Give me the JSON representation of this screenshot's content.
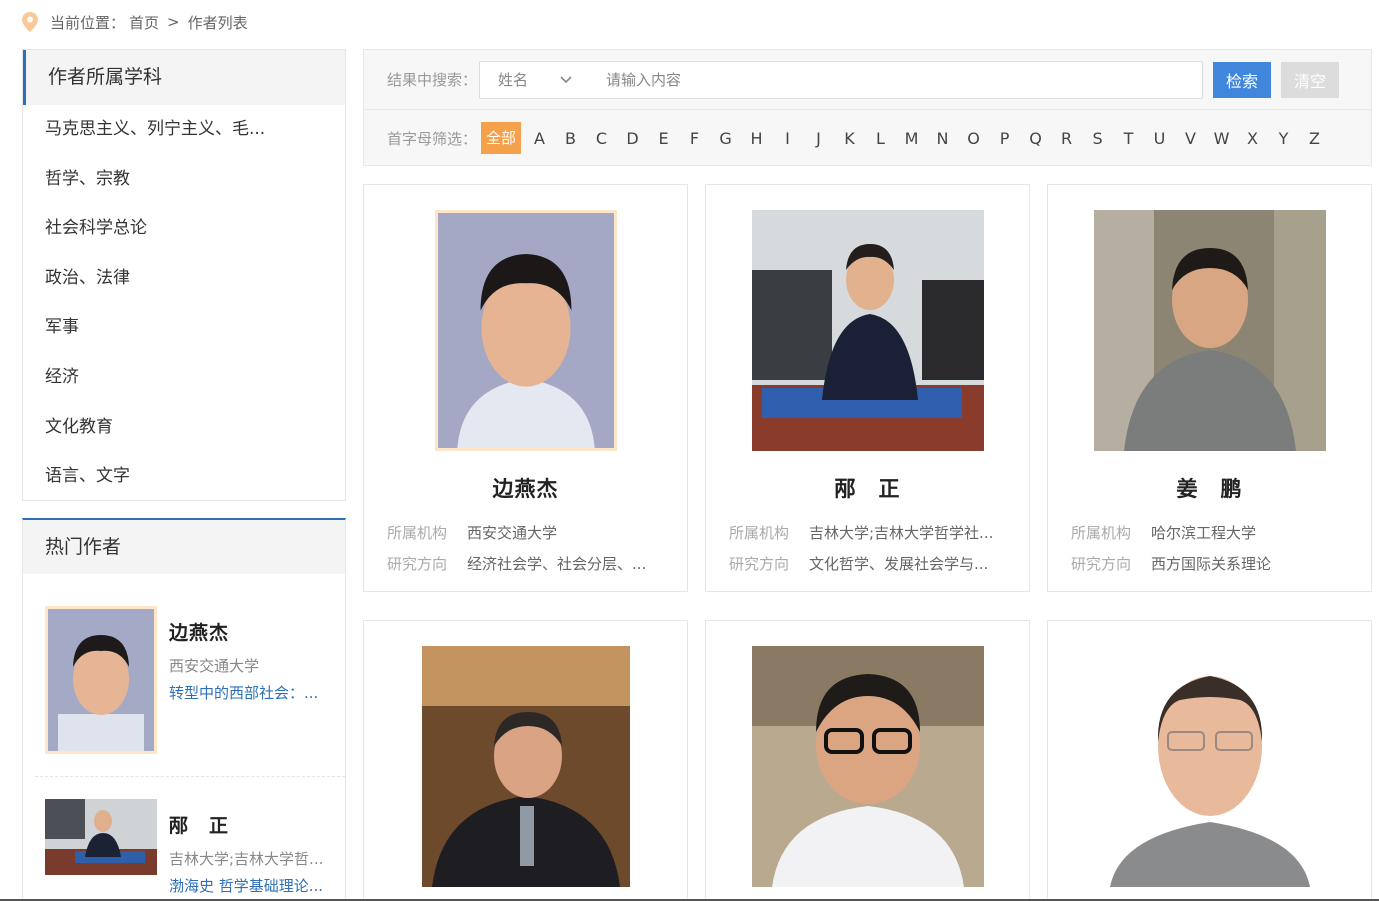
{
  "breadcrumb": {
    "prefix": "当前位置：",
    "home": "首页",
    "separator": ">",
    "current": "作者列表"
  },
  "subjects": {
    "title": "作者所属学科",
    "items": [
      "马克思主义、列宁主义、毛...",
      "哲学、宗教",
      "社会科学总论",
      "政治、法律",
      "军事",
      "经济",
      "文化教育",
      "语言、文字"
    ]
  },
  "hot": {
    "title": "热门作者",
    "items": [
      {
        "name": "边燕杰",
        "org": "西安交通大学",
        "book": "转型中的西部社会：..."
      },
      {
        "name": "邴　正",
        "org": "吉林大学;吉林大学哲...",
        "book": "渤海史 哲学基础理论..."
      }
    ]
  },
  "search": {
    "label": "结果中搜索：",
    "select_value": "姓名",
    "placeholder": "请输入内容",
    "search_button": "检索",
    "clear_button": "清空"
  },
  "letter_filter": {
    "label": "首字母筛选：",
    "all": "全部",
    "letters": [
      "A",
      "B",
      "C",
      "D",
      "E",
      "F",
      "G",
      "H",
      "I",
      "J",
      "K",
      "L",
      "M",
      "N",
      "O",
      "P",
      "Q",
      "R",
      "S",
      "T",
      "U",
      "V",
      "W",
      "X",
      "Y",
      "Z"
    ]
  },
  "card_labels": {
    "org": "所属机构",
    "field": "研究方向"
  },
  "authors": [
    {
      "name": "边燕杰",
      "org": "西安交通大学",
      "field": "经济社会学、社会分层、..."
    },
    {
      "name": "邴　正",
      "org": "吉林大学;吉林大学哲学社...",
      "field": "文化哲学、发展社会学与..."
    },
    {
      "name": "姜　鹏",
      "org": "哈尔滨工程大学",
      "field": "西方国际关系理论"
    }
  ],
  "colors": {
    "accent_blue": "#3f86dc",
    "accent_orange": "#f5a04b",
    "link_blue": "#2f6fba"
  }
}
